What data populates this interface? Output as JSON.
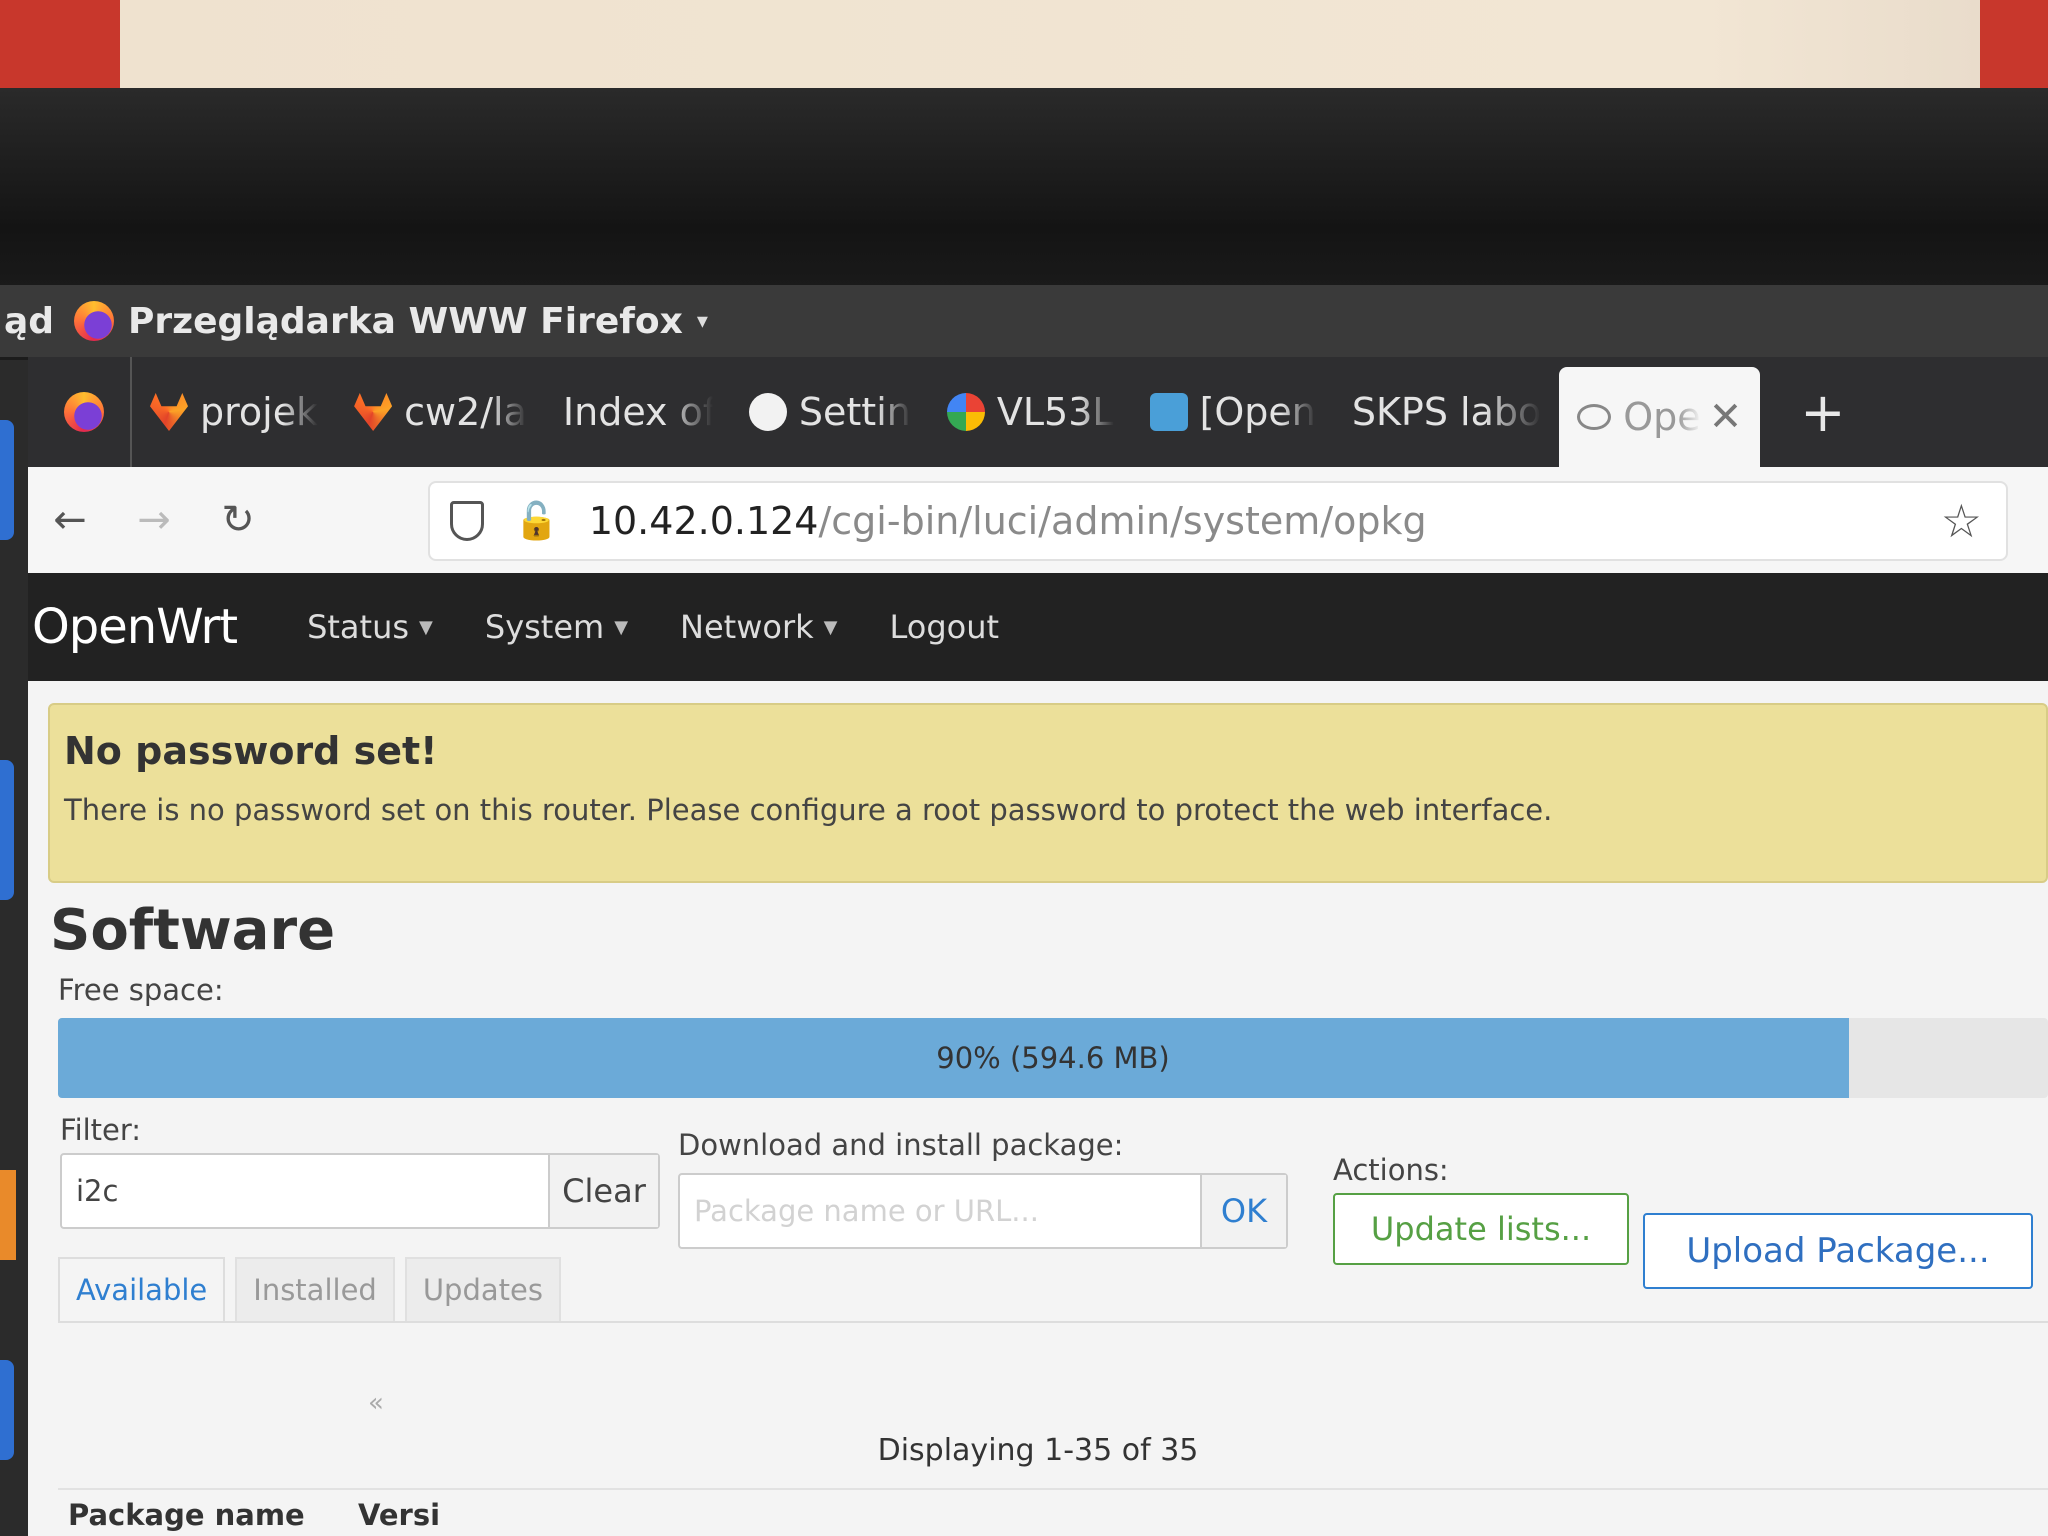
{
  "desktop_topbar": {
    "left_fragment": "ąd",
    "app_name": "Przeglądarka WWW Firefox",
    "menu_caret": "▾"
  },
  "browser": {
    "tabs": [
      {
        "label": "projek",
        "icon": "gitlab-icon"
      },
      {
        "label": "cw2/la",
        "icon": "gitlab-icon"
      },
      {
        "label": "Index of /",
        "icon": ""
      },
      {
        "label": "Settin",
        "icon": "github-icon"
      },
      {
        "label": "VL53L",
        "icon": "google-icon"
      },
      {
        "label": "[Open",
        "icon": "app-icon"
      },
      {
        "label": "SKPS labo",
        "icon": ""
      },
      {
        "label": "Ope",
        "icon": "wireless-icon",
        "active": true
      }
    ],
    "close_glyph": "✕",
    "new_tab_glyph": "+",
    "url_host": "10.42.0.124",
    "url_path": "/cgi-bin/luci/admin/system/opkg",
    "back_glyph": "←",
    "forward_glyph": "→",
    "reload_glyph": "↻",
    "star_glyph": "☆"
  },
  "openwrt": {
    "brand": "OpenWrt",
    "menu": [
      {
        "label": "Status",
        "dropdown": true
      },
      {
        "label": "System",
        "dropdown": true
      },
      {
        "label": "Network",
        "dropdown": true
      },
      {
        "label": "Logout",
        "dropdown": false
      }
    ],
    "alert": {
      "title": "No password set!",
      "text": "There is no password set on this router. Please configure a root password to protect the web interface."
    },
    "heading": "Software",
    "free_space": {
      "label": "Free space:",
      "percent": 90,
      "text": "90% (594.6 MB)"
    },
    "filter": {
      "label": "Filter:",
      "value": "i2c",
      "clear_label": "Clear"
    },
    "download": {
      "label": "Download and install package:",
      "placeholder": "Package name or URL...",
      "ok_label": "OK"
    },
    "actions": {
      "label": "Actions:",
      "update_label": "Update lists...",
      "upload_label": "Upload Package..."
    },
    "tabs": [
      {
        "label": "Available",
        "active": true
      },
      {
        "label": "Installed",
        "active": false
      },
      {
        "label": "Updates",
        "active": false
      }
    ],
    "pager_prev": "«",
    "displaying": "Displaying 1-35 of 35",
    "columns": [
      "Package name",
      "Versi"
    ]
  },
  "colors": {
    "alert_bg": "#ece09a",
    "progress_fill": "#6baad8",
    "link_blue": "#2f7fd0",
    "update_green": "#56a044",
    "header_bg": "#222222"
  }
}
